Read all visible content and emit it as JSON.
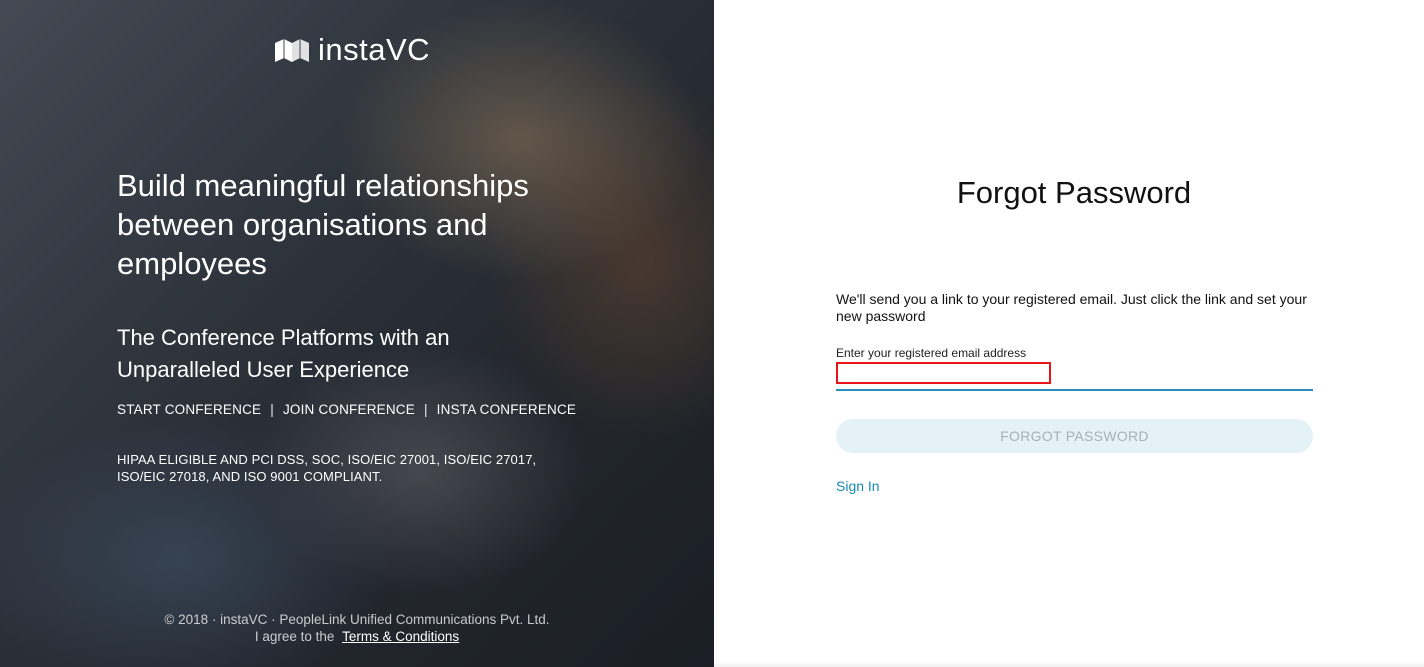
{
  "brand": {
    "name": "instaVC",
    "logo_icon": "book-logo-icon"
  },
  "hero": {
    "headline": "Build meaningful relationships between organisations and employees",
    "subheadline": "The Conference Platforms with an Unparalleled User Experience",
    "links": [
      {
        "label": "START CONFERENCE"
      },
      {
        "label": "JOIN CONFERENCE"
      },
      {
        "label": "INSTA CONFERENCE"
      }
    ],
    "separator": "|",
    "compliance": "HIPAA ELIGIBLE AND PCI DSS, SOC, ISO/EIC 27001, ISO/EIC 27017, ISO/EIC 27018, AND ISO 9001 COMPLIANT.",
    "footer": {
      "copyright": "© 2018 · instaVC · PeopleLink Unified Communications Pvt. Ltd.",
      "agree_text": "I agree to the",
      "terms_link": "Terms & Conditions"
    }
  },
  "form": {
    "title": "Forgot Password",
    "description": "We'll send you a link to your registered email. Just click the link and set your new password",
    "email_label": "Enter your registered email address",
    "email_value": "",
    "email_placeholder": "",
    "submit_label": "FORGOT PASSWORD",
    "signin_link": "Sign In"
  },
  "colors": {
    "accent": "#1a8ab5",
    "input_underline": "#2a8fb8",
    "error_outline": "#e8141a",
    "button_bg_disabled": "#e4f2f8",
    "button_text_disabled": "#a5b1b7"
  }
}
